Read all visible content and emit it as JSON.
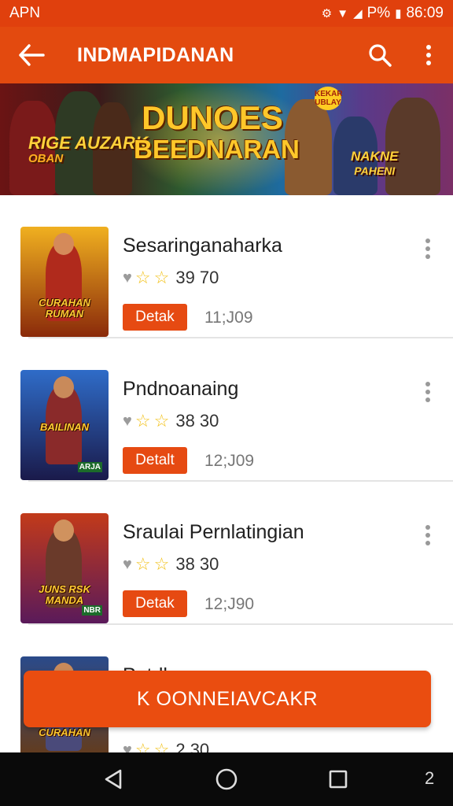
{
  "status_bar": {
    "carrier": "APN",
    "battery": "P%",
    "time": "86:09"
  },
  "app_bar": {
    "title": "INDMAPIDANAN",
    "icons": [
      "back-arrow-icon",
      "search-icon",
      "more-vert-icon"
    ]
  },
  "banner": {
    "left_line1": "RIGE AUZARK",
    "left_line2": "OBAN",
    "title_line1": "DUNOES",
    "title_line2": "BEEDNARAN",
    "badge": "KEKAR UBLAY",
    "right_line1": "NAKNE",
    "right_line2": "PAHENI"
  },
  "items": [
    {
      "title": "Sesaringanaharka",
      "rating": "39 70",
      "button": "Detak",
      "count": "11;J09",
      "thumb_line1": "CURAHAN",
      "thumb_line2": "RUMAN",
      "thumb_tag": "",
      "colors": {
        "bg_top": "#f0b020",
        "bg_bottom": "#8a2a0a",
        "hero": "#b02a1c",
        "head": "#d58a5a"
      }
    },
    {
      "title": "Pndnoanaing",
      "rating": "38 30",
      "button": "Detalt",
      "count": "12;J09",
      "thumb_line1": "BAILINAN",
      "thumb_line2": "",
      "thumb_tag": "ARJA",
      "colors": {
        "bg_top": "#2f6cc8",
        "bg_bottom": "#1a1a4a",
        "hero": "#8a2a2a",
        "head": "#c98a5a"
      }
    },
    {
      "title": "Sraulai Pernlatingian",
      "rating": "38 30",
      "button": "Detak",
      "count": "12;J90",
      "thumb_line1": "JUNS RSK",
      "thumb_line2": "MANDA",
      "thumb_tag": "NBR",
      "colors": {
        "bg_top": "#c23a1a",
        "bg_bottom": "#5a1a5a",
        "hero": "#6a3a2a",
        "head": "#d0925e"
      }
    },
    {
      "title": "Pntrlh",
      "rating": "2 30",
      "button": "",
      "count": "",
      "thumb_line1": "CURAHAN",
      "thumb_line2": "",
      "thumb_tag": "",
      "colors": {
        "bg_top": "#2a4a8a",
        "bg_bottom": "#6a3a10",
        "hero": "#4a4a7a",
        "head": "#c98a5a"
      }
    }
  ],
  "cta": {
    "label": "K OONNEIAVCAKR"
  },
  "nav_bar": {
    "number": "2",
    "icons": [
      "back-triangle-icon",
      "home-circle-icon",
      "recents-square-icon"
    ]
  }
}
